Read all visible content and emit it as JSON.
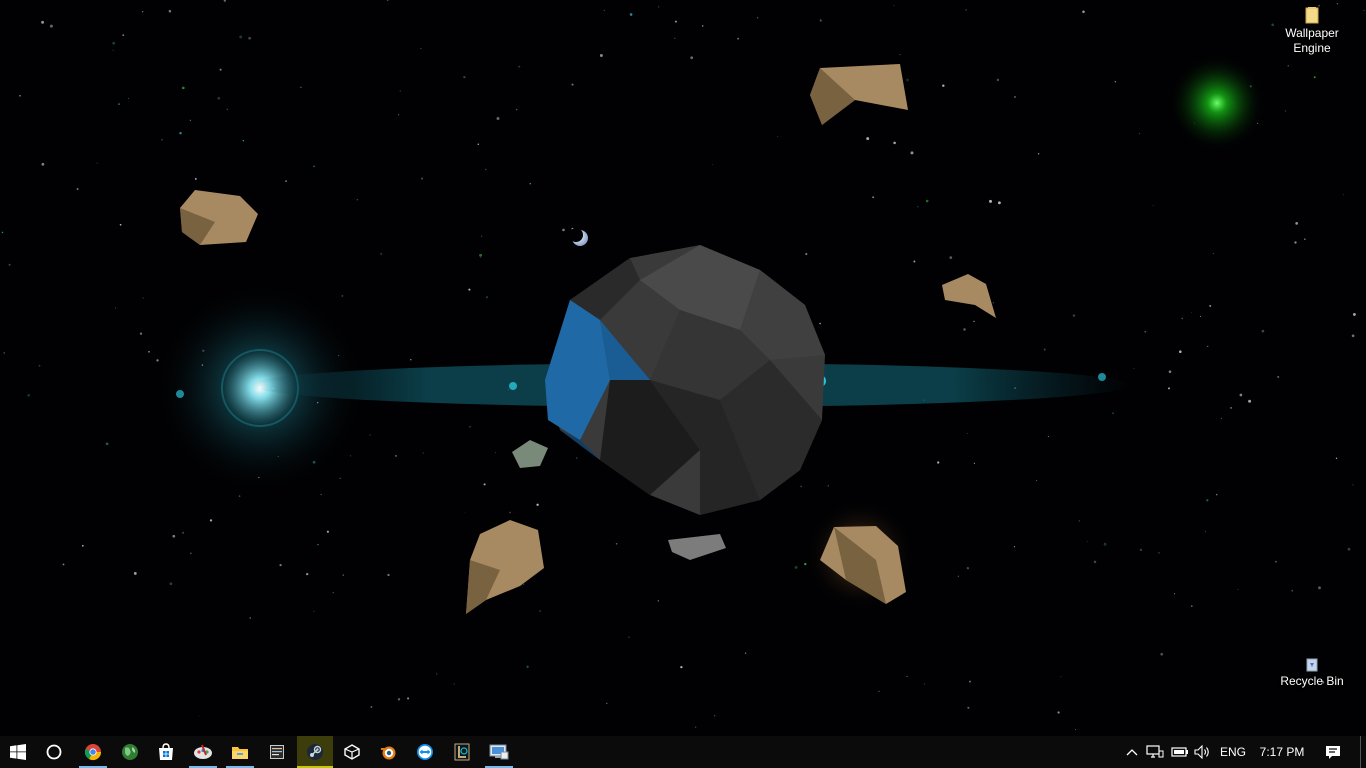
{
  "desktop": {
    "icons": [
      {
        "label": "Wallpaper Engine",
        "icon": "folder-icon"
      },
      {
        "label": "Recycle Bin",
        "icon": "recycle-bin-icon"
      }
    ]
  },
  "taskbar": {
    "start": {
      "icon": "windows-start-icon"
    },
    "cortana": {
      "icon": "cortana-circle-icon"
    },
    "pinned_apps": [
      {
        "name": "chrome",
        "icon": "chrome-icon",
        "running": true
      },
      {
        "name": "world",
        "icon": "globe-icon",
        "running": false
      },
      {
        "name": "store",
        "icon": "store-icon",
        "running": false
      },
      {
        "name": "paint",
        "icon": "paint-icon",
        "running": true
      },
      {
        "name": "file-explorer",
        "icon": "folder-icon",
        "running": true
      },
      {
        "name": "notepad",
        "icon": "notepad-icon",
        "running": false
      },
      {
        "name": "steam",
        "icon": "steam-icon",
        "running": true,
        "active": true
      },
      {
        "name": "unity",
        "icon": "unity-icon",
        "running": false
      },
      {
        "name": "blender",
        "icon": "blender-icon",
        "running": false
      },
      {
        "name": "teamviewer",
        "icon": "teamviewer-icon",
        "running": false
      },
      {
        "name": "league",
        "icon": "league-icon",
        "running": false
      },
      {
        "name": "remote-desktop",
        "icon": "remote-desktop-icon",
        "running": true
      }
    ],
    "tray": {
      "chevron": "chevron-up-icon",
      "network": "network-icon",
      "battery": "battery-icon",
      "volume": "volume-icon",
      "language": "ENG",
      "time": "7:17 PM",
      "action_center": "action-center-icon"
    }
  },
  "colors": {
    "accent": "#76b9ed",
    "active_app": "#c8c800",
    "taskbar_bg": "#0b0b0b"
  }
}
